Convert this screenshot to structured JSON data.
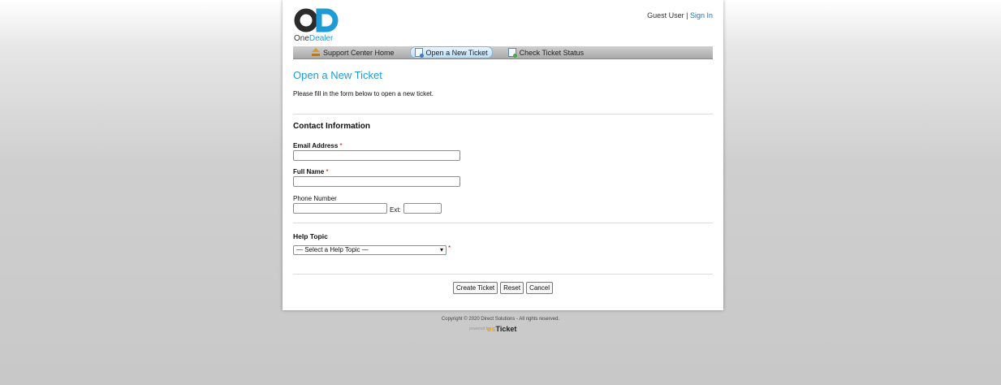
{
  "brand": {
    "name_part1": "One",
    "name_part2": "Dealer",
    "accent": "#1d9bd6"
  },
  "usernav": {
    "guest": "Guest User",
    "separator": "|",
    "sign_in": "Sign In"
  },
  "nav": {
    "items": [
      {
        "label": "Support Center Home",
        "icon": "home-icon",
        "active": false
      },
      {
        "label": "Open a New Ticket",
        "icon": "new-ticket-icon",
        "active": true
      },
      {
        "label": "Check Ticket Status",
        "icon": "ticket-status-icon",
        "active": false
      }
    ]
  },
  "page": {
    "title": "Open a New Ticket",
    "intro": "Please fill in the form below to open a new ticket."
  },
  "contact": {
    "heading": "Contact Information",
    "email_label": "Email Address",
    "email_value": "",
    "name_label": "Full Name",
    "name_value": "",
    "phone_label": "Phone Number",
    "phone_value": "",
    "ext_label": "Ext:",
    "ext_value": "",
    "required_mark": "*"
  },
  "help": {
    "heading": "Help Topic",
    "selected": "— Select a Help Topic —",
    "required_mark": "*"
  },
  "buttons": {
    "create": "Create Ticket",
    "reset": "Reset",
    "cancel": "Cancel"
  },
  "footer": {
    "copyright": "Copyright © 2020 Direct Solutions - All rights reserved.",
    "powered_by": "powered by",
    "osticket_a": "os",
    "osticket_b": "Ticket"
  }
}
